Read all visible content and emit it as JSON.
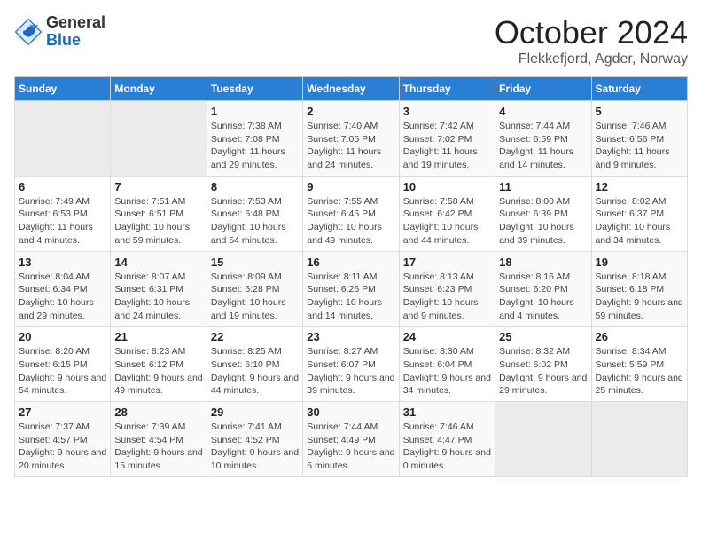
{
  "header": {
    "logo_general": "General",
    "logo_blue": "Blue",
    "month_title": "October 2024",
    "location": "Flekkefjord, Agder, Norway"
  },
  "days_of_week": [
    "Sunday",
    "Monday",
    "Tuesday",
    "Wednesday",
    "Thursday",
    "Friday",
    "Saturday"
  ],
  "weeks": [
    [
      {
        "day": null
      },
      {
        "day": null
      },
      {
        "day": "1",
        "sunrise": "7:38 AM",
        "sunset": "7:08 PM",
        "daylight": "11 hours and 29 minutes."
      },
      {
        "day": "2",
        "sunrise": "7:40 AM",
        "sunset": "7:05 PM",
        "daylight": "11 hours and 24 minutes."
      },
      {
        "day": "3",
        "sunrise": "7:42 AM",
        "sunset": "7:02 PM",
        "daylight": "11 hours and 19 minutes."
      },
      {
        "day": "4",
        "sunrise": "7:44 AM",
        "sunset": "6:59 PM",
        "daylight": "11 hours and 14 minutes."
      },
      {
        "day": "5",
        "sunrise": "7:46 AM",
        "sunset": "6:56 PM",
        "daylight": "11 hours and 9 minutes."
      }
    ],
    [
      {
        "day": "6",
        "sunrise": "7:49 AM",
        "sunset": "6:53 PM",
        "daylight": "11 hours and 4 minutes."
      },
      {
        "day": "7",
        "sunrise": "7:51 AM",
        "sunset": "6:51 PM",
        "daylight": "10 hours and 59 minutes."
      },
      {
        "day": "8",
        "sunrise": "7:53 AM",
        "sunset": "6:48 PM",
        "daylight": "10 hours and 54 minutes."
      },
      {
        "day": "9",
        "sunrise": "7:55 AM",
        "sunset": "6:45 PM",
        "daylight": "10 hours and 49 minutes."
      },
      {
        "day": "10",
        "sunrise": "7:58 AM",
        "sunset": "6:42 PM",
        "daylight": "10 hours and 44 minutes."
      },
      {
        "day": "11",
        "sunrise": "8:00 AM",
        "sunset": "6:39 PM",
        "daylight": "10 hours and 39 minutes."
      },
      {
        "day": "12",
        "sunrise": "8:02 AM",
        "sunset": "6:37 PM",
        "daylight": "10 hours and 34 minutes."
      }
    ],
    [
      {
        "day": "13",
        "sunrise": "8:04 AM",
        "sunset": "6:34 PM",
        "daylight": "10 hours and 29 minutes."
      },
      {
        "day": "14",
        "sunrise": "8:07 AM",
        "sunset": "6:31 PM",
        "daylight": "10 hours and 24 minutes."
      },
      {
        "day": "15",
        "sunrise": "8:09 AM",
        "sunset": "6:28 PM",
        "daylight": "10 hours and 19 minutes."
      },
      {
        "day": "16",
        "sunrise": "8:11 AM",
        "sunset": "6:26 PM",
        "daylight": "10 hours and 14 minutes."
      },
      {
        "day": "17",
        "sunrise": "8:13 AM",
        "sunset": "6:23 PM",
        "daylight": "10 hours and 9 minutes."
      },
      {
        "day": "18",
        "sunrise": "8:16 AM",
        "sunset": "6:20 PM",
        "daylight": "10 hours and 4 minutes."
      },
      {
        "day": "19",
        "sunrise": "8:18 AM",
        "sunset": "6:18 PM",
        "daylight": "9 hours and 59 minutes."
      }
    ],
    [
      {
        "day": "20",
        "sunrise": "8:20 AM",
        "sunset": "6:15 PM",
        "daylight": "9 hours and 54 minutes."
      },
      {
        "day": "21",
        "sunrise": "8:23 AM",
        "sunset": "6:12 PM",
        "daylight": "9 hours and 49 minutes."
      },
      {
        "day": "22",
        "sunrise": "8:25 AM",
        "sunset": "6:10 PM",
        "daylight": "9 hours and 44 minutes."
      },
      {
        "day": "23",
        "sunrise": "8:27 AM",
        "sunset": "6:07 PM",
        "daylight": "9 hours and 39 minutes."
      },
      {
        "day": "24",
        "sunrise": "8:30 AM",
        "sunset": "6:04 PM",
        "daylight": "9 hours and 34 minutes."
      },
      {
        "day": "25",
        "sunrise": "8:32 AM",
        "sunset": "6:02 PM",
        "daylight": "9 hours and 29 minutes."
      },
      {
        "day": "26",
        "sunrise": "8:34 AM",
        "sunset": "5:59 PM",
        "daylight": "9 hours and 25 minutes."
      }
    ],
    [
      {
        "day": "27",
        "sunrise": "7:37 AM",
        "sunset": "4:57 PM",
        "daylight": "9 hours and 20 minutes."
      },
      {
        "day": "28",
        "sunrise": "7:39 AM",
        "sunset": "4:54 PM",
        "daylight": "9 hours and 15 minutes."
      },
      {
        "day": "29",
        "sunrise": "7:41 AM",
        "sunset": "4:52 PM",
        "daylight": "9 hours and 10 minutes."
      },
      {
        "day": "30",
        "sunrise": "7:44 AM",
        "sunset": "4:49 PM",
        "daylight": "9 hours and 5 minutes."
      },
      {
        "day": "31",
        "sunrise": "7:46 AM",
        "sunset": "4:47 PM",
        "daylight": "9 hours and 0 minutes."
      },
      {
        "day": null
      },
      {
        "day": null
      }
    ]
  ]
}
